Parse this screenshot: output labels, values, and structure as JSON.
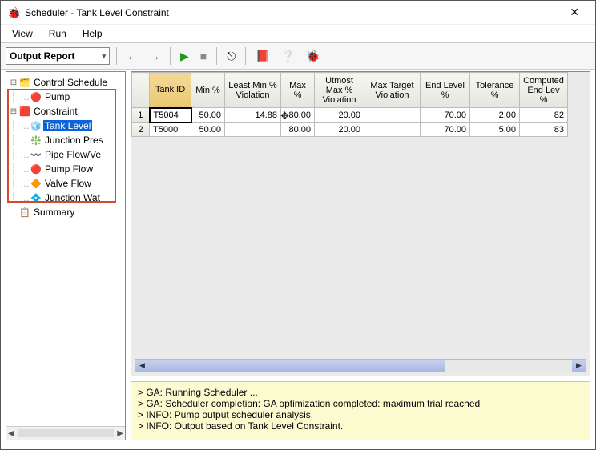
{
  "window": {
    "title": "Scheduler - Tank Level Constraint",
    "close": "✕"
  },
  "menu": {
    "view": "View",
    "run": "Run",
    "help": "Help"
  },
  "toolbar": {
    "report_label": "Output Report",
    "back": "←",
    "forward": "→",
    "play": "▶",
    "stop": "■",
    "tool1": "⎋",
    "book": "📕",
    "help": "❔",
    "bug": "🐞"
  },
  "tree": {
    "root": "Control Schedule",
    "pump": "Pump",
    "constraint": "Constraint",
    "items": [
      "Tank Level",
      "Junction Pres",
      "Pipe Flow/Ve",
      "Pump Flow",
      "Valve Flow",
      "Junction Wat"
    ],
    "summary": "Summary"
  },
  "grid": {
    "headers": [
      "",
      "Tank ID",
      "Min %",
      "Least Min % Violation",
      "Max %",
      "Utmost Max % Violation",
      "Max Target Violation",
      "End Level %",
      "Tolerance %",
      "Computed End Lev %"
    ],
    "rows": [
      {
        "n": "1",
        "id": "T5004",
        "min": "50.00",
        "lmin": "14.88",
        "max": "80.00",
        "umax": "20.00",
        "mtv": "",
        "end": "70.00",
        "tol": "2.00",
        "comp": "82"
      },
      {
        "n": "2",
        "id": "T5000",
        "min": "50.00",
        "lmin": "",
        "max": "80.00",
        "umax": "20.00",
        "mtv": "",
        "end": "70.00",
        "tol": "5.00",
        "comp": "83"
      }
    ]
  },
  "log": {
    "l1": "> GA: Running Scheduler ...",
    "l2": "> GA: Scheduler completion: GA optimization completed: maximum trial reached",
    "l3": "> INFO: Pump output scheduler analysis.",
    "l4": "> INFO: Output based on Tank Level Constraint."
  }
}
